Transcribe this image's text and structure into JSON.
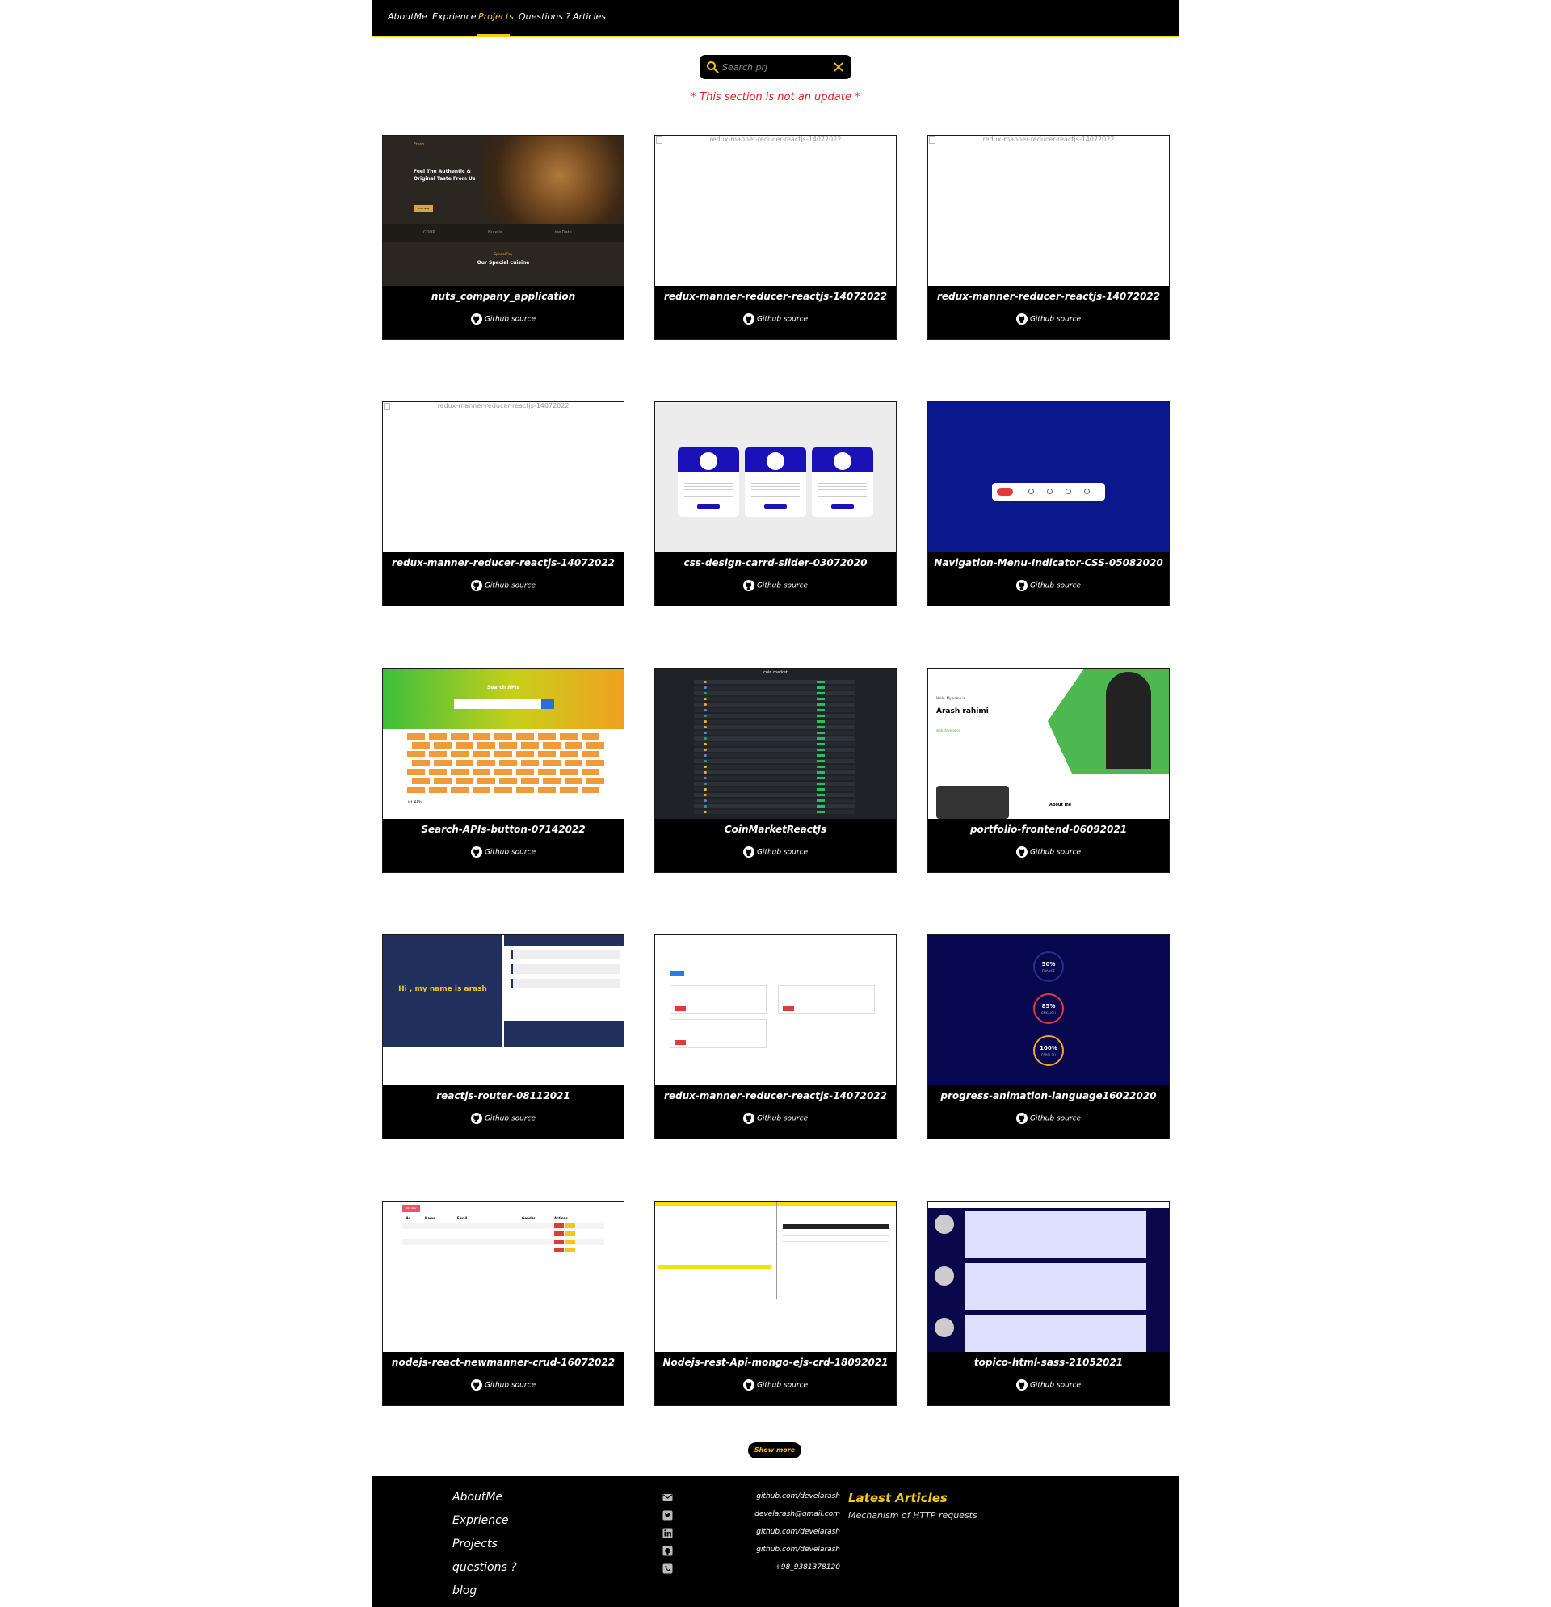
{
  "nav": {
    "items": [
      {
        "label": "AboutMe"
      },
      {
        "label": "Exprience"
      },
      {
        "label": "Projects",
        "active": true
      },
      {
        "label": "Questions ?"
      },
      {
        "label": "Articles"
      }
    ],
    "accent_color": "#f5c518"
  },
  "search": {
    "placeholder": "Search prj",
    "value": ""
  },
  "notice": "* This section is not an update *",
  "projects": [
    {
      "title": "nuts_company_application",
      "link": "Github source",
      "thumb": "nuts"
    },
    {
      "title": "redux-manner-reducer-reactjs-14072022",
      "link": "Github source",
      "thumb": "broken",
      "alt": "redux-manner-reducer-reactjs-14072022"
    },
    {
      "title": "redux-manner-reducer-reactjs-14072022",
      "link": "Github source",
      "thumb": "broken",
      "alt": "redux-manner-reducer-reactjs-14072022"
    },
    {
      "title": "redux-manner-reducer-reactjs-14072022",
      "link": "Github source",
      "thumb": "broken",
      "alt": "redux-manner-reducer-reactjs-14072022"
    },
    {
      "title": "css-design-carrd-slider-03072020",
      "link": "Github source",
      "thumb": "slider"
    },
    {
      "title": "Navigation-Menu-Indicator-CSS-05082020",
      "link": "Github source",
      "thumb": "navmenu"
    },
    {
      "title": "Search-APIs-button-07142022",
      "link": "Github source",
      "thumb": "apis"
    },
    {
      "title": "CoinMarketReactJs",
      "link": "Github source",
      "thumb": "coin"
    },
    {
      "title": "portfolio-frontend-06092021",
      "link": "Github source",
      "thumb": "portfolio"
    },
    {
      "title": "reactjs-router-08112021",
      "link": "Github source",
      "thumb": "router"
    },
    {
      "title": "redux-manner-reducer-reactjs-14072022",
      "link": "Github source",
      "thumb": "redux"
    },
    {
      "title": "progress-animation-language16022020",
      "link": "Github source",
      "thumb": "progress"
    },
    {
      "title": "nodejs-react-newmanner-crud-16072022",
      "link": "Github source",
      "thumb": "crud"
    },
    {
      "title": "Nodejs-rest-Api-mongo-ejs-crd-18092021",
      "link": "Github source",
      "thumb": "rest"
    },
    {
      "title": "topico-html-sass-21052021",
      "link": "Github source",
      "thumb": "topico"
    }
  ],
  "thumb_text": {
    "nuts_heading": "Feel The Authentic & Original Taste From Us",
    "nuts_logo": "Fresh",
    "nuts_button": "Shop Now",
    "nuts_special": "Special Pay",
    "nuts_sub": "Our Special cuisine",
    "nuts_brands": [
      "COOP",
      "Nutella",
      "Live Date"
    ],
    "coin_title": "coin market",
    "portfolio_hello": "Hello, My name is",
    "portfolio_name": "Arash rahimi",
    "portfolio_role": "web developer",
    "portfolio_about": "About me",
    "router_hero": "Hi , my name is arash",
    "apis_title": "Search APIs",
    "apis_list": "List APIs",
    "progress_items": [
      {
        "pct": "50%",
        "lang": "FRANCE"
      },
      {
        "pct": "85%",
        "lang": "ENGLISH"
      },
      {
        "pct": "100%",
        "lang": "FARSI PH"
      }
    ],
    "crud_add": "Add User",
    "crud_headers": [
      "No",
      "Name",
      "Email",
      "Gender",
      "Actions"
    ]
  },
  "show_more": "Show more",
  "footer": {
    "nav": [
      "AboutMe",
      "Exprience",
      "Projects",
      "questions ?",
      "blog"
    ],
    "contacts": [
      {
        "icon": "mail-icon",
        "text": "github.com/develarash"
      },
      {
        "icon": "twitter-icon",
        "text": "develarash@gmail.com"
      },
      {
        "icon": "linkedin-icon",
        "text": "github.com/develarash"
      },
      {
        "icon": "github-icon",
        "text": "github.com/develarash"
      },
      {
        "icon": "phone-icon",
        "text": "+98_9381378120"
      }
    ],
    "latest_title": "Latest Articles",
    "latest_items": [
      "Mechanism of HTTP requests"
    ]
  }
}
